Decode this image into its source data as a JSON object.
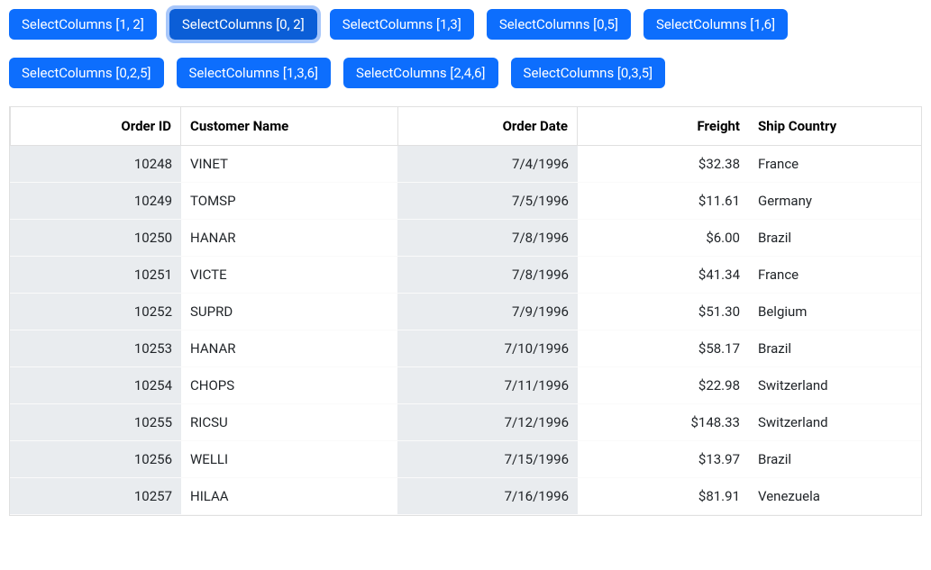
{
  "buttons_row1": [
    {
      "label": "SelectColumns [1, 2]",
      "active": false
    },
    {
      "label": "SelectColumns [0, 2]",
      "active": true
    },
    {
      "label": "SelectColumns [1,3]",
      "active": false
    },
    {
      "label": "SelectColumns [0,5]",
      "active": false
    },
    {
      "label": "SelectColumns [1,6]",
      "active": false
    }
  ],
  "buttons_row2": [
    {
      "label": "SelectColumns [0,2,5]",
      "active": false
    },
    {
      "label": "SelectColumns [1,3,6]",
      "active": false
    },
    {
      "label": "SelectColumns [2,4,6]",
      "active": false
    },
    {
      "label": "SelectColumns [0,3,5]",
      "active": false
    }
  ],
  "columns": {
    "orderid": "Order ID",
    "customer": "Customer Name",
    "date": "Order Date",
    "freight": "Freight",
    "country": "Ship Country"
  },
  "rows": [
    {
      "orderid": "10248",
      "customer": "VINET",
      "date": "7/4/1996",
      "freight": "$32.38",
      "country": "France"
    },
    {
      "orderid": "10249",
      "customer": "TOMSP",
      "date": "7/5/1996",
      "freight": "$11.61",
      "country": "Germany"
    },
    {
      "orderid": "10250",
      "customer": "HANAR",
      "date": "7/8/1996",
      "freight": "$6.00",
      "country": "Brazil"
    },
    {
      "orderid": "10251",
      "customer": "VICTE",
      "date": "7/8/1996",
      "freight": "$41.34",
      "country": "France"
    },
    {
      "orderid": "10252",
      "customer": "SUPRD",
      "date": "7/9/1996",
      "freight": "$51.30",
      "country": "Belgium"
    },
    {
      "orderid": "10253",
      "customer": "HANAR",
      "date": "7/10/1996",
      "freight": "$58.17",
      "country": "Brazil"
    },
    {
      "orderid": "10254",
      "customer": "CHOPS",
      "date": "7/11/1996",
      "freight": "$22.98",
      "country": "Switzerland"
    },
    {
      "orderid": "10255",
      "customer": "RICSU",
      "date": "7/12/1996",
      "freight": "$148.33",
      "country": "Switzerland"
    },
    {
      "orderid": "10256",
      "customer": "WELLI",
      "date": "7/15/1996",
      "freight": "$13.97",
      "country": "Brazil"
    },
    {
      "orderid": "10257",
      "customer": "HILAA",
      "date": "7/16/1996",
      "freight": "$81.91",
      "country": "Venezuela"
    }
  ]
}
